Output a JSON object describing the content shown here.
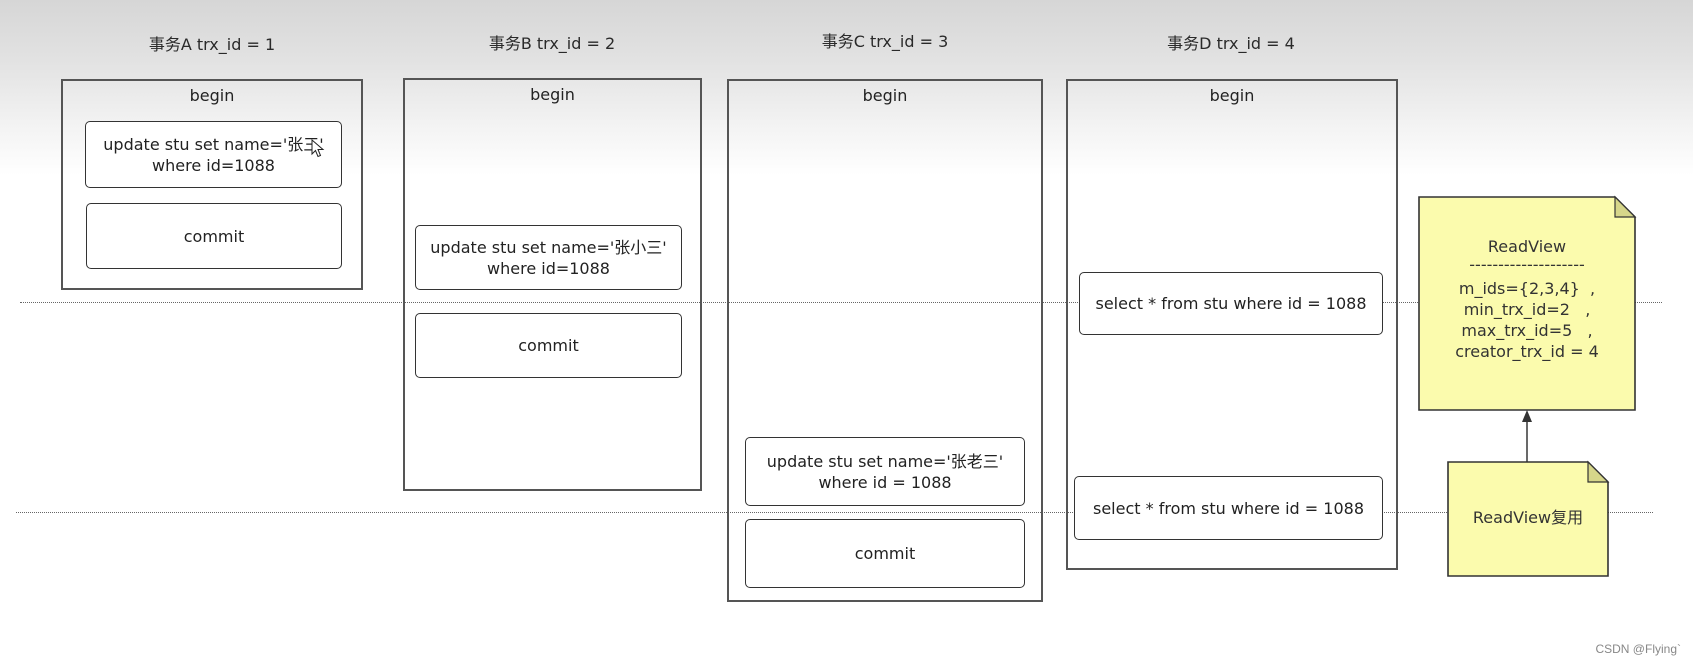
{
  "transactions": [
    {
      "title": "事务A trx_id = 1",
      "begin": "begin",
      "statements": [
        {
          "lines": [
            "update stu set name='张三'",
            "where id=1088"
          ]
        },
        {
          "lines": [
            "commit"
          ]
        }
      ]
    },
    {
      "title": "事务B trx_id = 2",
      "begin": "begin",
      "statements": [
        {
          "lines": [
            "update stu set name='张小三'",
            "where id=1088"
          ]
        },
        {
          "lines": [
            "commit"
          ]
        }
      ]
    },
    {
      "title": "事务C trx_id = 3",
      "begin": "begin",
      "statements": [
        {
          "lines": [
            "update stu set name='张老三'",
            "where id = 1088"
          ]
        },
        {
          "lines": [
            "commit"
          ]
        }
      ]
    },
    {
      "title": "事务D trx_id = 4",
      "begin": "begin",
      "statements": [
        {
          "lines": [
            "select * from stu where id = 1088"
          ]
        },
        {
          "lines": [
            "select * from stu where id = 1088"
          ]
        }
      ]
    }
  ],
  "readview": {
    "title": "ReadView",
    "separator": "--------------------",
    "fields": [
      "m_ids={2,3,4}  ,",
      "min_trx_id=2   ,",
      "max_trx_id=5   ,",
      "creator_trx_id = 4"
    ]
  },
  "readview_reuse": {
    "label": "ReadView复用"
  },
  "colors": {
    "note_fill": "#fbfbad",
    "note_fold": "#d6d68a",
    "border": "#333333"
  },
  "watermark": "CSDN @Flying`"
}
